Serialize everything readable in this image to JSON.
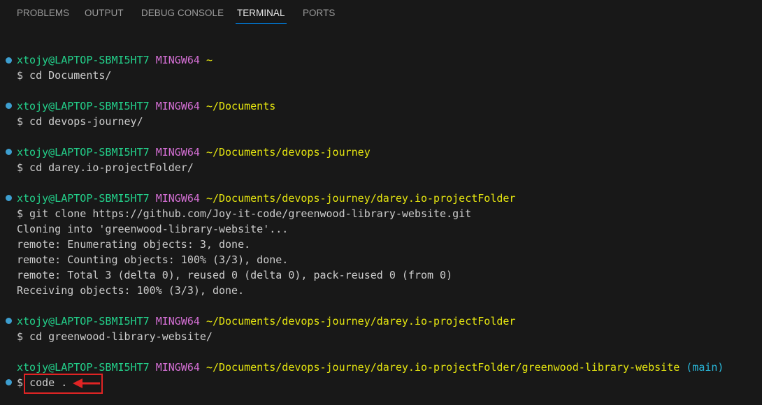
{
  "tabs": [
    {
      "label": "PROBLEMS"
    },
    {
      "label": "OUTPUT"
    },
    {
      "label": "DEBUG CONSOLE"
    },
    {
      "label": "TERMINAL",
      "active": true
    },
    {
      "label": "PORTS"
    }
  ],
  "prompt": {
    "user_host": "xtojy@LAPTOP-SBMI5HT7",
    "system": "MINGW64"
  },
  "blocks": [
    {
      "path": "~",
      "command": "$ cd Documents/"
    },
    {
      "path": "~/Documents",
      "command": "$ cd devops-journey/"
    },
    {
      "path": "~/Documents/devops-journey",
      "command": "$ cd darey.io-projectFolder/"
    },
    {
      "path": "~/Documents/devops-journey/darey.io-projectFolder",
      "command": "$ git clone https://github.com/Joy-it-code/greenwood-library-website.git",
      "output": [
        "Cloning into 'greenwood-library-website'...",
        "remote: Enumerating objects: 3, done.",
        "remote: Counting objects: 100% (3/3), done.",
        "remote: Total 3 (delta 0), reused 0 (delta 0), pack-reused 0 (from 0)",
        "Receiving objects: 100% (3/3), done."
      ]
    },
    {
      "path": "~/Documents/devops-journey/darey.io-projectFolder",
      "command": "$ cd greenwood-library-website/"
    },
    {
      "path": "~/Documents/devops-journey/darey.io-projectFolder/greenwood-library-website",
      "branch": "(main)",
      "command_prefix": "$",
      "command": "code ."
    }
  ],
  "colors": {
    "background": "#181818",
    "user_host": "#23d18b",
    "system": "#d670d6",
    "path": "#e5e510",
    "branch": "#29b8db",
    "text": "#cccccc",
    "decoration_dot": "#3d9ecf",
    "annotation": "#e02424",
    "active_tab_underline": "#0078d4"
  }
}
